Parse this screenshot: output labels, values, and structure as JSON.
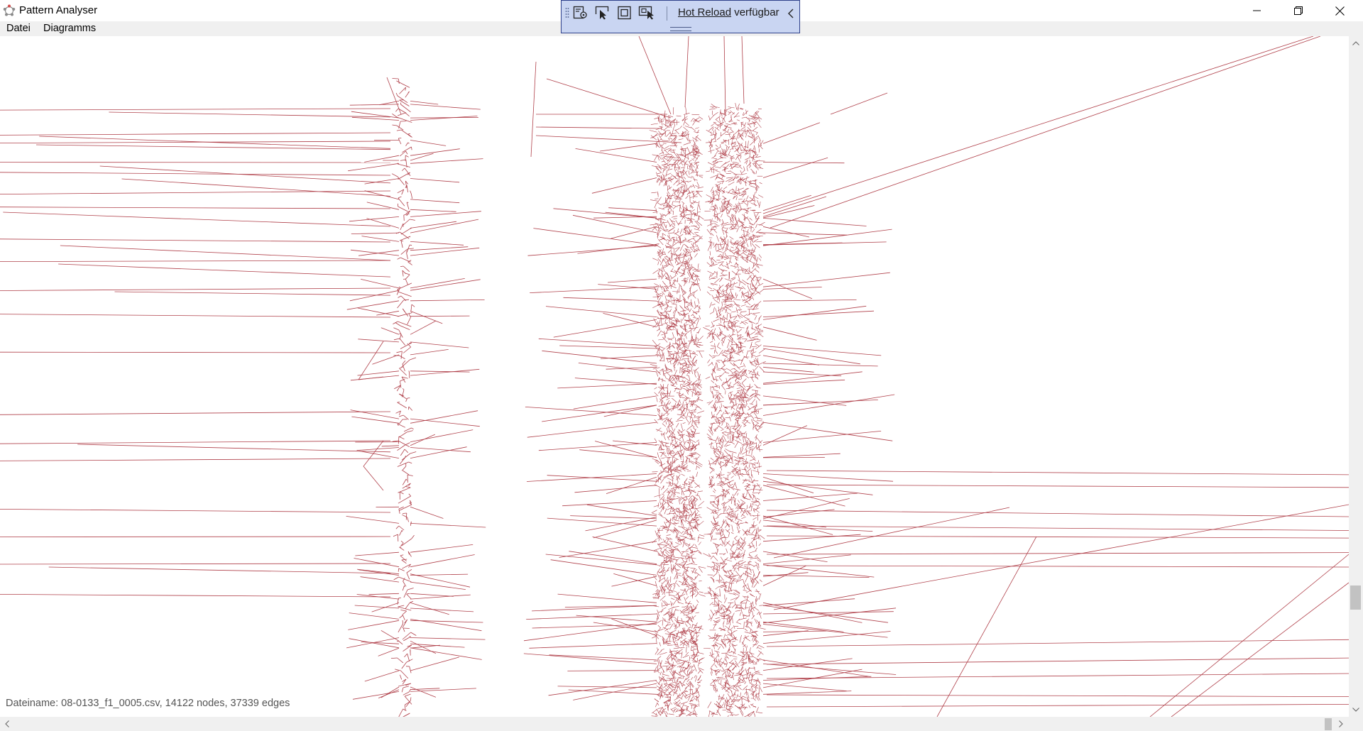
{
  "window": {
    "title": "Pattern Analyser",
    "controls": {
      "minimize": "minimize-icon",
      "maximize": "restore-icon",
      "close": "close-icon"
    }
  },
  "menu": {
    "items": [
      {
        "label": "Datei"
      },
      {
        "label": "Diagramms"
      }
    ]
  },
  "hot_reload_toolbar": {
    "link_text": "Hot Reload",
    "status_text": " verfügbar",
    "icons": [
      "live-visual-tree-icon",
      "select-element-icon",
      "display-layout-adorners-icon",
      "track-focused-element-icon"
    ],
    "background": "#c9d5f2"
  },
  "graph": {
    "edge_color": "#b0404a",
    "info": "Dateiname: 08-0133_f1_0005.csv, 14122 nodes, 37339 edges"
  }
}
